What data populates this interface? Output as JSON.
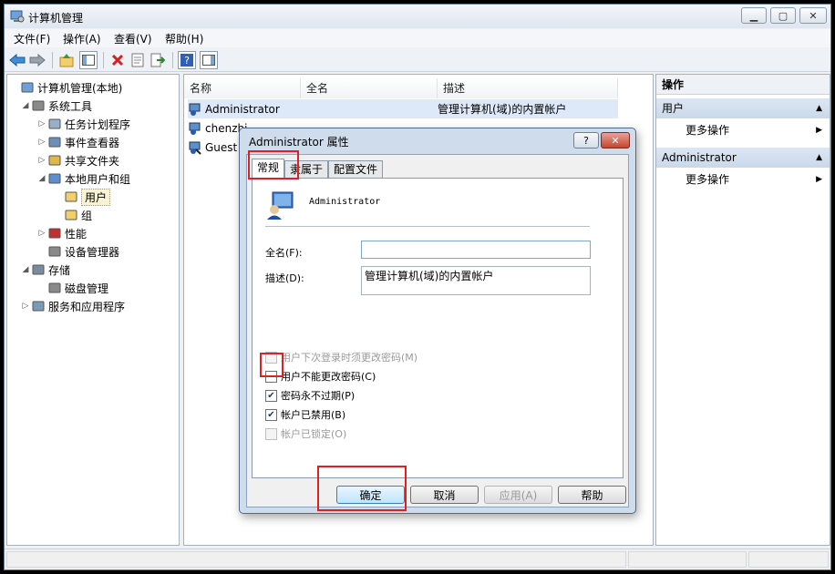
{
  "window": {
    "title": "计算机管理",
    "min_icon": "minimize-icon",
    "max_icon": "maximize-icon",
    "close_icon": "close-icon"
  },
  "menu": [
    "文件(F)",
    "操作(A)",
    "查看(V)",
    "帮助(H)"
  ],
  "toolbar": {
    "icons": [
      "back-icon",
      "forward-icon",
      "up-folder-icon",
      "show-hide-tree-icon",
      "delete-icon",
      "properties-icon",
      "export-icon",
      "help-icon",
      "show-action-pane-icon"
    ]
  },
  "tree": [
    {
      "label": "计算机管理(本地)",
      "icon": "computer-icon",
      "arrow": ""
    },
    {
      "label": "系统工具",
      "icon": "tools-icon",
      "arrow": "◢"
    },
    {
      "label": "任务计划程序",
      "icon": "clock-icon",
      "arrow": "▷"
    },
    {
      "label": "事件查看器",
      "icon": "event-viewer-icon",
      "arrow": "▷"
    },
    {
      "label": "共享文件夹",
      "icon": "shared-folder-icon",
      "arrow": "▷"
    },
    {
      "label": "本地用户和组",
      "icon": "users-group-icon",
      "arrow": "◢"
    },
    {
      "label": "用户",
      "icon": "folder-icon",
      "arrow": ""
    },
    {
      "label": "组",
      "icon": "folder-icon",
      "arrow": ""
    },
    {
      "label": "性能",
      "icon": "performance-icon",
      "arrow": "▷"
    },
    {
      "label": "设备管理器",
      "icon": "device-manager-icon",
      "arrow": ""
    },
    {
      "label": "存储",
      "icon": "storage-icon",
      "arrow": "◢"
    },
    {
      "label": "磁盘管理",
      "icon": "disk-icon",
      "arrow": ""
    },
    {
      "label": "服务和应用程序",
      "icon": "services-icon",
      "arrow": "▷"
    }
  ],
  "list": {
    "columns": [
      "名称",
      "全名",
      "描述"
    ],
    "rows": [
      {
        "name": "Administrator",
        "fullname": "",
        "desc": "管理计算机(域)的内置帐户"
      },
      {
        "name": "chenzhi...",
        "fullname": "",
        "desc": ""
      },
      {
        "name": "Guest",
        "fullname": "",
        "desc": ""
      }
    ]
  },
  "actions": {
    "header": "操作",
    "groups": [
      {
        "title": "用户",
        "item": "更多操作"
      },
      {
        "title": "Administrator",
        "item": "更多操作"
      }
    ]
  },
  "dialog": {
    "title": "Administrator 属性",
    "help_btn": "?",
    "close_btn": "✕",
    "tabs": [
      "常规",
      "隶属于",
      "配置文件"
    ],
    "username": "Administrator",
    "fullname_label": "全名(F):",
    "fullname_value": "",
    "desc_label": "描述(D):",
    "desc_value": "管理计算机(域)的内置帐户",
    "checkboxes": [
      {
        "label": "用户下次登录时须更改密码(M)",
        "checked": false,
        "disabled": true
      },
      {
        "label": "用户不能更改密码(C)",
        "checked": false,
        "disabled": false
      },
      {
        "label": "密码永不过期(P)",
        "checked": true,
        "disabled": false
      },
      {
        "label": "帐户已禁用(B)",
        "checked": true,
        "disabled": false
      },
      {
        "label": "帐户已锁定(O)",
        "checked": false,
        "disabled": true
      }
    ],
    "buttons": {
      "ok": "确定",
      "cancel": "取消",
      "apply": "应用(A)",
      "help": "帮助"
    }
  },
  "colors": {
    "highlight": "#e02020",
    "selection": "#dde9f8",
    "check": "#1c3a78"
  }
}
